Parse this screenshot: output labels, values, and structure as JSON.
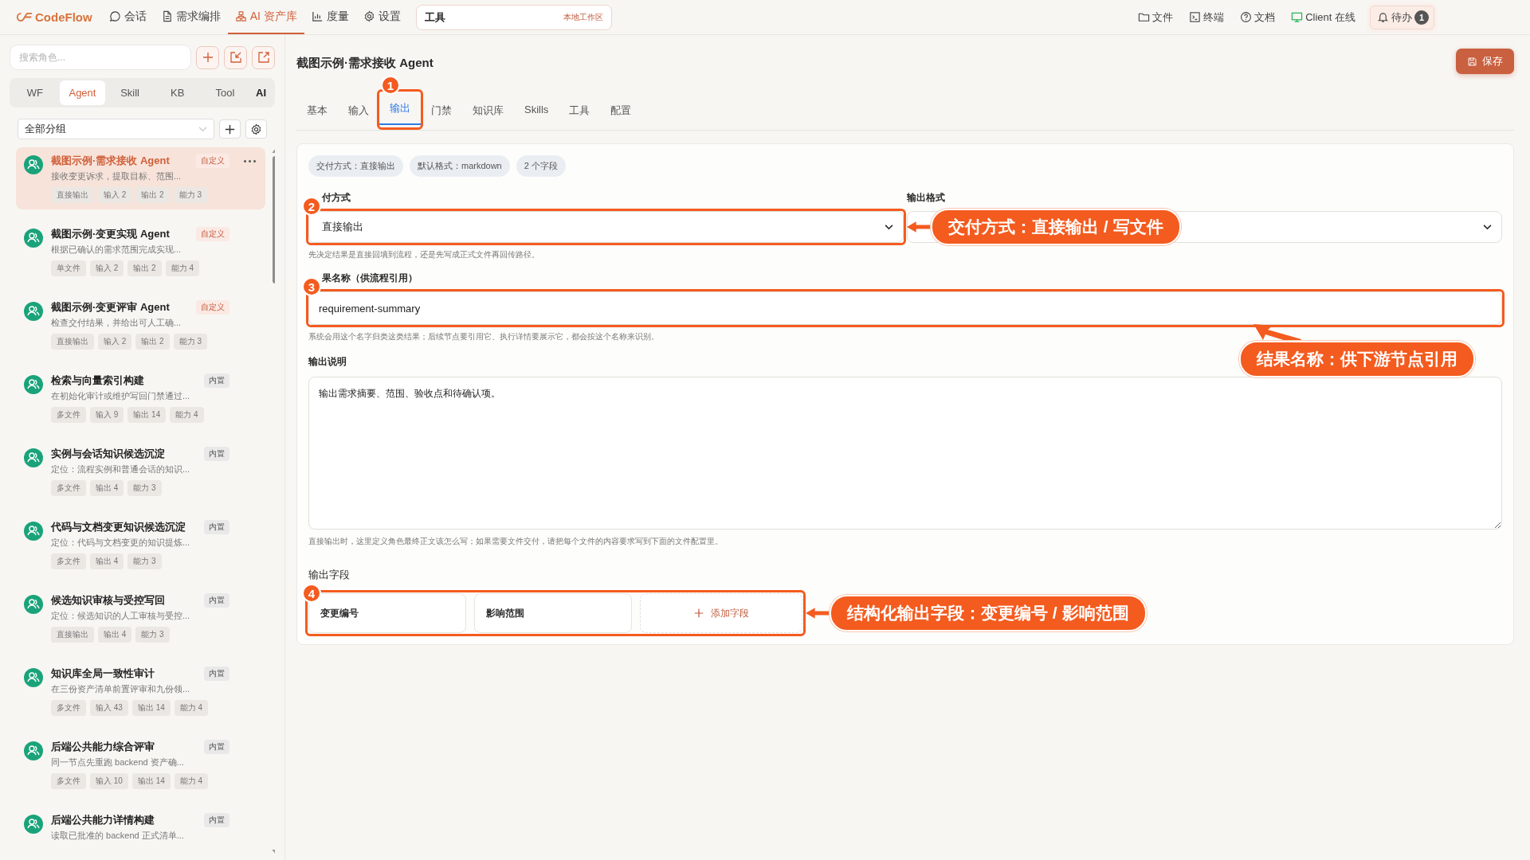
{
  "topbar": {
    "logo": "CodeFlow",
    "nav": [
      {
        "label": "会话",
        "selected": false
      },
      {
        "label": "需求编排",
        "selected": false
      },
      {
        "label": "AI 资产库",
        "selected": true
      },
      {
        "label": "度量",
        "selected": false
      },
      {
        "label": "设置",
        "selected": false
      }
    ],
    "search": {
      "value": "工具",
      "scope": "本地工作区"
    },
    "actions": [
      "文件",
      "终端",
      "文档",
      "Client 在线"
    ],
    "todo": {
      "label": "待办",
      "count": "1"
    }
  },
  "sidebar": {
    "search": {
      "placeholder": "搜索角色..."
    },
    "tabs": [
      {
        "label": "WF",
        "selected": false
      },
      {
        "label": "Agent",
        "selected": true
      },
      {
        "label": "Skill",
        "selected": false
      },
      {
        "label": "KB",
        "selected": false
      },
      {
        "label": "Tool",
        "selected": false
      },
      {
        "label": "AI",
        "selected": false
      }
    ],
    "group": "全部分组",
    "items": [
      {
        "title": "截图示例·需求接收 Agent",
        "desc": "接收变更诉求，提取目标、范围...",
        "badge": "自定义",
        "kind": "custom",
        "selected": true,
        "tags": [
          "直接输出",
          "输入 2",
          "输出 2",
          "能力 3"
        ]
      },
      {
        "title": "截图示例·变更实现 Agent",
        "desc": "根据已确认的需求范围完成实现...",
        "badge": "自定义",
        "kind": "custom",
        "selected": false,
        "tags": [
          "单文件",
          "输入 2",
          "输出 2",
          "能力 4"
        ]
      },
      {
        "title": "截图示例·变更评审 Agent",
        "desc": "检查交付结果，并给出可人工确...",
        "badge": "自定义",
        "kind": "custom",
        "selected": false,
        "tags": [
          "直接输出",
          "输入 2",
          "输出 2",
          "能力 3"
        ]
      },
      {
        "title": "检索与向量索引构建",
        "desc": "在初始化审计或维护写回门禁通过...",
        "badge": "内置",
        "kind": "builtin",
        "selected": false,
        "tags": [
          "多文件",
          "输入 9",
          "输出 14",
          "能力 4"
        ]
      },
      {
        "title": "实例与会话知识候选沉淀",
        "desc": "定位：流程实例和普通会话的知识...",
        "badge": "内置",
        "kind": "builtin",
        "selected": false,
        "tags": [
          "多文件",
          "输出 4",
          "能力 3"
        ]
      },
      {
        "title": "代码与文档变更知识候选沉淀",
        "desc": "定位：代码与文档变更的知识提炼...",
        "badge": "内置",
        "kind": "builtin",
        "selected": false,
        "tags": [
          "多文件",
          "输出 4",
          "能力 3"
        ]
      },
      {
        "title": "候选知识审核与受控写回",
        "desc": "定位：候选知识的人工审核与受控...",
        "badge": "内置",
        "kind": "builtin",
        "selected": false,
        "tags": [
          "直接输出",
          "输出 4",
          "能力 3"
        ]
      },
      {
        "title": "知识库全局一致性审计",
        "desc": "在三份资产清单前置评审和九份领...",
        "badge": "内置",
        "kind": "builtin",
        "selected": false,
        "tags": [
          "多文件",
          "输入 43",
          "输出 14",
          "能力 4"
        ]
      },
      {
        "title": "后端公共能力综合评审",
        "desc": "同一节点先重跑 backend 资产确...",
        "badge": "内置",
        "kind": "builtin",
        "selected": false,
        "tags": [
          "多文件",
          "输入 10",
          "输出 14",
          "能力 4"
        ]
      },
      {
        "title": "后端公共能力详情构建",
        "desc": "读取已批准的 backend 正式清单...",
        "badge": "内置",
        "kind": "builtin",
        "selected": false
      }
    ]
  },
  "editor": {
    "title": "截图示例·需求接收 Agent",
    "save": "保存",
    "tabs": [
      {
        "label": "基本",
        "selected": false
      },
      {
        "label": "输入",
        "selected": false
      },
      {
        "label": "输出",
        "selected": true,
        "marker": "1"
      },
      {
        "label": "门禁",
        "selected": false
      },
      {
        "label": "知识库",
        "selected": false
      },
      {
        "label": "Skills",
        "selected": false
      },
      {
        "label": "工具",
        "selected": false
      },
      {
        "label": "配置",
        "selected": false
      }
    ],
    "chips": [
      "交付方式：直接输出",
      "默认格式：markdown",
      "2 个字段"
    ],
    "delivery": {
      "label": "付方式",
      "value": "直接输出",
      "hint": "先决定结果是直接回填到流程，还是先写成正式文件再回传路径。",
      "marker": "2",
      "callout": "交付方式：直接输出 / 写文件"
    },
    "format": {
      "label": "输出格式"
    },
    "name": {
      "label": "果名称（供流程引用）",
      "value": "requirement-summary",
      "hint": "系统会用这个名字归类这类结果；后续节点要引用它、执行详情要展示它，都会按这个名称来识别。",
      "marker": "3",
      "callout": "结果名称：供下游节点引用"
    },
    "description": {
      "label": "输出说明",
      "value": "输出需求摘要、范围、验收点和待确认项。",
      "hint": "直接输出时，这里定义角色最终正文该怎么写；如果需要文件交付，请把每个文件的内容要求写到下面的文件配置里。"
    },
    "fields": {
      "label": "输出字段",
      "items": [
        "变更编号",
        "影响范围"
      ],
      "add": "添加字段",
      "marker": "4",
      "callout": "结构化输出字段：变更编号 / 影响范围"
    }
  }
}
